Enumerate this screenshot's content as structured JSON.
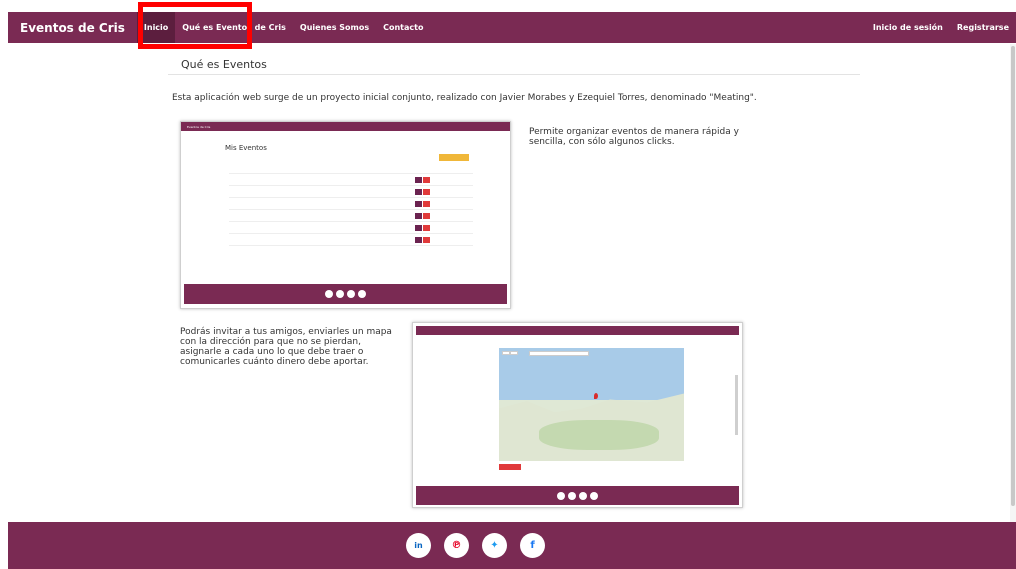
{
  "navbar": {
    "brand": "Eventos de Cris",
    "items": [
      {
        "label": "Inicio"
      },
      {
        "label": "Qué es Eventos de Cris"
      },
      {
        "label": "Quienes Somos"
      },
      {
        "label": "Contacto"
      }
    ],
    "right_items": [
      {
        "label": "Inicio de sesión"
      },
      {
        "label": "Registrarse"
      }
    ]
  },
  "main": {
    "title": "Qué es Eventos",
    "intro": "Esta aplicación web surge de un proyecto inicial conjunto, realizado con Javier Morabes y Ezequiel Torres, denominado \"Meating\".",
    "feature1": "Permite organizar eventos de manera rápida y sencilla, con sólo algunos clicks.",
    "feature2": "Podrás invitar a tus amigos, enviarles un mapa con la dirección para que no se pierdan, asignarle a cada uno lo que debe traer o comunicarles cuánto dinero debe aportar."
  },
  "screenshot1": {
    "nav_brand": "Eventos de Cris",
    "heading": "Mis Eventos"
  },
  "footer": {
    "social": [
      {
        "icon": "linkedin-icon",
        "glyph": "in"
      },
      {
        "icon": "pinterest-icon",
        "glyph": "℗"
      },
      {
        "icon": "twitter-icon",
        "glyph": "✦"
      },
      {
        "icon": "facebook-icon",
        "glyph": "f"
      }
    ]
  },
  "colors": {
    "navbar": "#7a2a53",
    "active_nav": "#5c1e3e",
    "highlight": "#ff0000",
    "footer": "#7a2a53"
  }
}
